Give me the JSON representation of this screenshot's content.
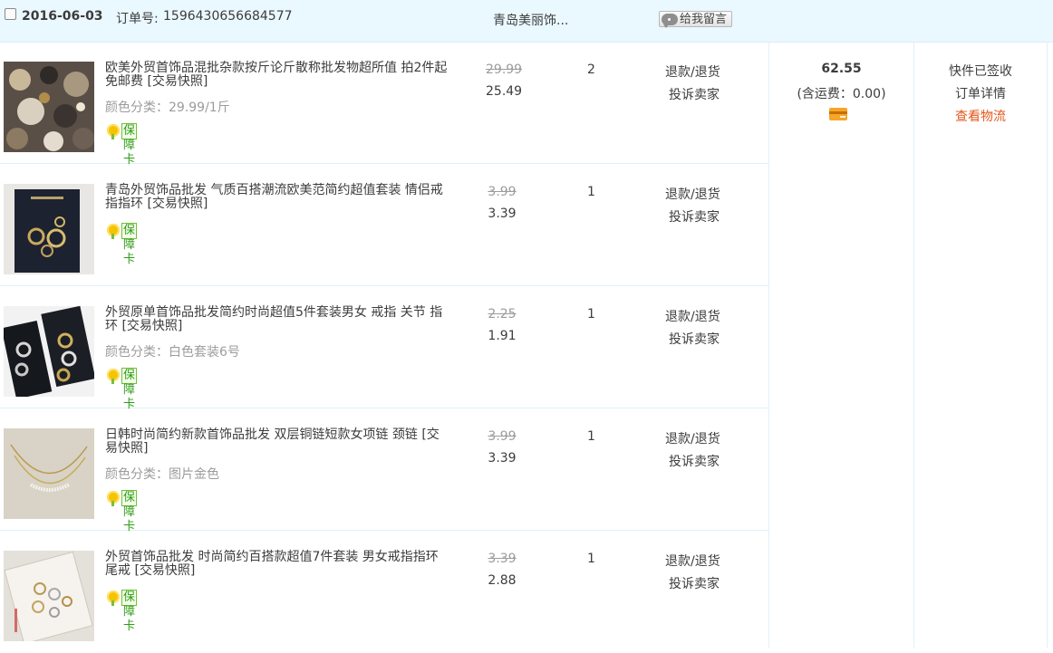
{
  "order": {
    "date": "2016-06-03",
    "order_no_label": "订单号:",
    "order_no": "1596430656684577",
    "shop_name": "青岛美丽饰...",
    "message_button": "给我留言"
  },
  "summary": {
    "total": "62.55",
    "shipping": "(含运费：0.00)",
    "payment_icon": "card-payment-icon"
  },
  "status": {
    "state": "快件已签收",
    "detail_link": "订单详情",
    "logistics_link": "查看物流"
  },
  "colors": {
    "header_bg": "#eaf8ff",
    "link_orange": "#e4561b",
    "badge_green": "#2f9a16"
  },
  "items": [
    {
      "title": "欧美外贸首饰品混批杂款按斤论斤散称批发物超所值 拍2件起免邮费 [交易快照]",
      "sku": "颜色分类：29.99/1斤",
      "badge": "保障卡",
      "price_orig": "29.99",
      "price_now": "25.49",
      "qty": "2",
      "action1": "退款/退货",
      "action2": "投诉卖家"
    },
    {
      "title": "青岛外贸饰品批发 气质百搭潮流欧美范简约超值套装 情侣戒指指环 [交易快照]",
      "sku": "",
      "badge": "保障卡",
      "price_orig": "3.99",
      "price_now": "3.39",
      "qty": "1",
      "action1": "退款/退货",
      "action2": "投诉卖家"
    },
    {
      "title": "外贸原单首饰品批发简约时尚超值5件套装男女 戒指 关节 指环 [交易快照]",
      "sku": "颜色分类：白色套装6号",
      "badge": "保障卡",
      "price_orig": "2.25",
      "price_now": "1.91",
      "qty": "1",
      "action1": "退款/退货",
      "action2": "投诉卖家"
    },
    {
      "title": "日韩时尚简约新款首饰品批发 双层铜链短款女项链 颈链 [交易快照]",
      "sku": "颜色分类：图片金色",
      "badge": "保障卡",
      "price_orig": "3.99",
      "price_now": "3.39",
      "qty": "1",
      "action1": "退款/退货",
      "action2": "投诉卖家"
    },
    {
      "title": "外贸首饰品批发 时尚简约百搭款超值7件套装 男女戒指指环尾戒 [交易快照]",
      "sku": "",
      "badge": "保障卡",
      "price_orig": "3.39",
      "price_now": "2.88",
      "qty": "1",
      "action1": "退款/退货",
      "action2": "投诉卖家"
    }
  ]
}
